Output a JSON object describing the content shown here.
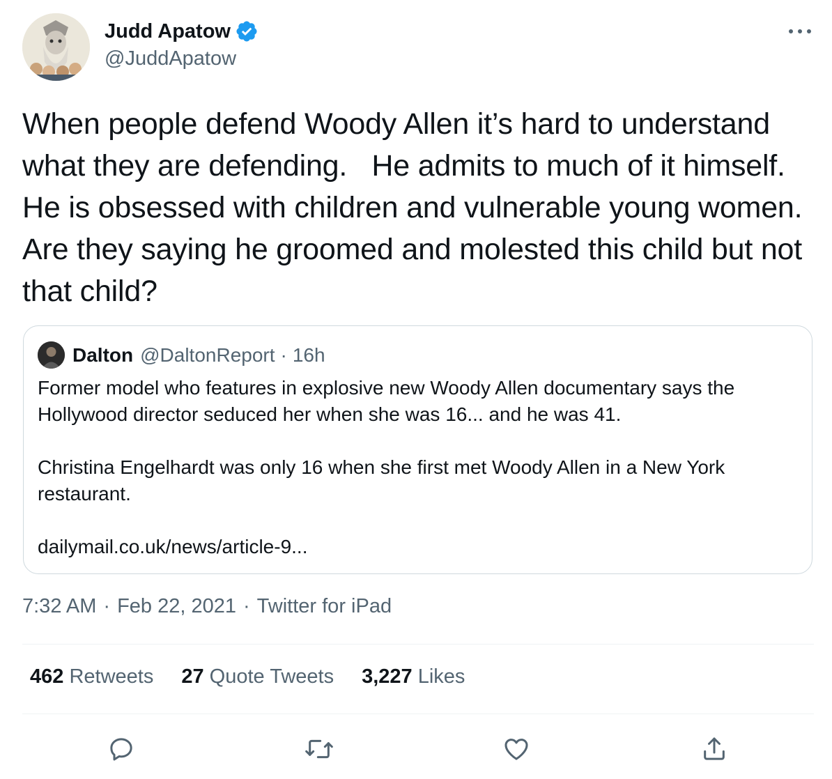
{
  "author": {
    "name": "Judd Apatow",
    "handle": "@JuddApatow"
  },
  "tweet_text": "When people defend Woody Allen it’s hard to understand what they are defending.   He admits to much of it himself.  He is obsessed with children and vulnerable young women.  Are they saying he groomed and molested this child but not that child?",
  "quoted": {
    "name": "Dalton",
    "handle": "@DaltonReport",
    "dot": "·",
    "time": "16h",
    "text": "Former model who features in explosive new Woody Allen documentary says the Hollywood director seduced her when she was 16... and he was 41.\n\nChristina Engelhardt was only 16 when she first met Woody Allen in a New York restaurant.\n\ndailymail.co.uk/news/article-9..."
  },
  "meta": {
    "time": "7:32 AM",
    "sep1": "·",
    "date": "Feb 22, 2021",
    "sep2": "·",
    "source": "Twitter for iPad"
  },
  "stats": {
    "retweets_count": "462",
    "retweets_label": "Retweets",
    "quotes_count": "27",
    "quotes_label": "Quote Tweets",
    "likes_count": "3,227",
    "likes_label": "Likes"
  },
  "icons": {
    "verified": "verified-badge-icon",
    "more": "more-horizontal-icon",
    "reply": "reply-icon",
    "retweet": "retweet-icon",
    "like": "heart-icon",
    "share": "share-icon"
  },
  "colors": {
    "verified": "#1d9bf0",
    "secondary_text": "#536471",
    "border": "#cfd9de"
  }
}
